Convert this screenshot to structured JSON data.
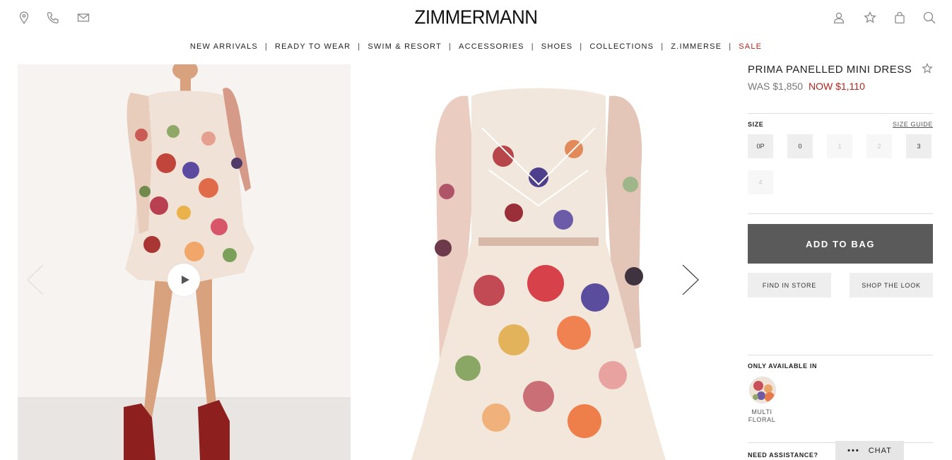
{
  "header": {
    "brand": "ZIMMERMANN",
    "left_icons": [
      "location-pin-icon",
      "phone-icon",
      "mail-icon"
    ],
    "right_icons": [
      "account-icon",
      "wishlist-star-icon",
      "bag-icon",
      "search-icon"
    ]
  },
  "nav": {
    "items": [
      {
        "label": "NEW ARRIVALS"
      },
      {
        "label": "READY TO WEAR"
      },
      {
        "label": "SWIM & RESORT"
      },
      {
        "label": "ACCESSORIES"
      },
      {
        "label": "SHOES"
      },
      {
        "label": "COLLECTIONS"
      },
      {
        "label": "Z.IMMERSE"
      },
      {
        "label": "SALE"
      }
    ],
    "separator": "|",
    "sale_color": "#b3261e"
  },
  "gallery": {
    "play_icon": "play-icon",
    "prev_icon": "chevron-left-icon",
    "next_icon": "chevron-right-icon"
  },
  "product": {
    "title": "PRIMA PANELLED MINI DRESS",
    "was_price": "WAS $1,850",
    "now_price": "NOW $1,110",
    "size_label": "SIZE",
    "size_guide": "SIZE GUIDE",
    "sizes": [
      {
        "label": "0P",
        "available": true
      },
      {
        "label": "0",
        "available": true
      },
      {
        "label": "1",
        "available": false
      },
      {
        "label": "2",
        "available": false
      },
      {
        "label": "3",
        "available": true
      },
      {
        "label": "4",
        "available": false
      }
    ],
    "add_to_bag": "ADD TO BAG",
    "find_in_store": "FIND IN STORE",
    "shop_the_look": "SHOP THE LOOK",
    "only_available_in": "ONLY AVAILABLE IN",
    "swatch_label_line1": "MULTI",
    "swatch_label_line2": "FLORAL",
    "need_assistance": "NEED ASSISTANCE?"
  },
  "chat": {
    "dots": "•••",
    "label": "CHAT"
  },
  "colors": {
    "accent_sale": "#b3261e",
    "primary_button": "#5a5a5a",
    "secondary_button": "#eeeeee"
  }
}
